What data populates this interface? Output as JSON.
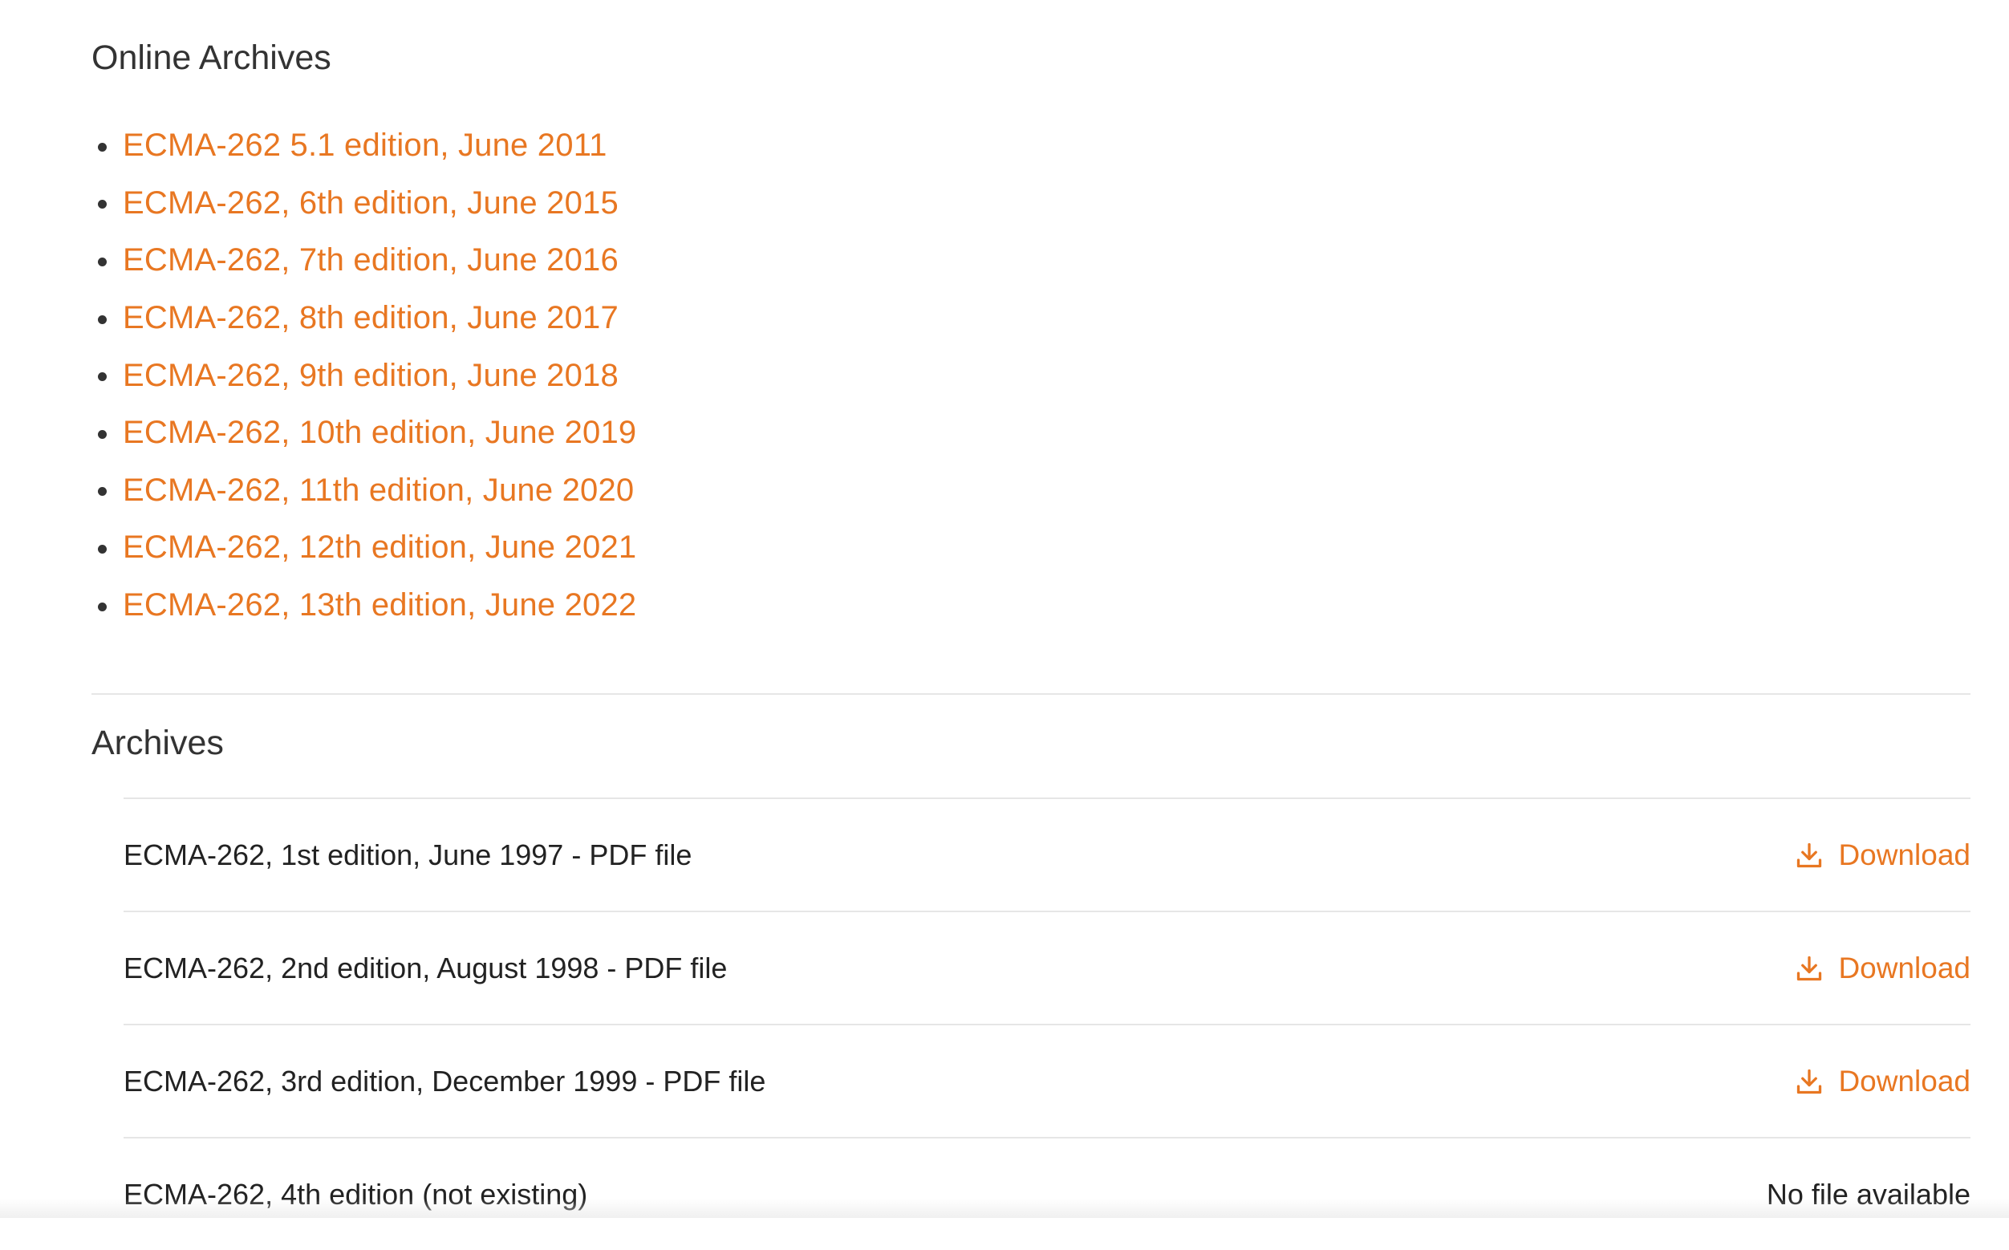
{
  "online_archives": {
    "title": "Online Archives",
    "links": [
      "ECMA-262 5.1 edition, June 2011",
      "ECMA-262, 6th edition, June 2015",
      "ECMA-262, 7th edition, June 2016",
      "ECMA-262, 8th edition, June 2017",
      "ECMA-262, 9th edition, June 2018",
      "ECMA-262, 10th edition, June 2019",
      "ECMA-262, 11th edition, June 2020",
      "ECMA-262, 12th edition, June 2021",
      "ECMA-262, 13th edition, June 2022"
    ]
  },
  "archives": {
    "title": "Archives",
    "rows": [
      {
        "title": "ECMA-262, 1st edition, June 1997 - PDF file",
        "action": "Download",
        "icon": "download-icon"
      },
      {
        "title": "ECMA-262, 2nd edition, August 1998 - PDF file",
        "action": "Download",
        "icon": "download-icon"
      },
      {
        "title": "ECMA-262, 3rd edition, December 1999 - PDF file",
        "action": "Download",
        "icon": "download-icon"
      },
      {
        "title": "ECMA-262, 4th edition (not existing)",
        "status": "No file available"
      }
    ]
  },
  "colors": {
    "accent": "#e87722",
    "text": "#222222",
    "divider": "#e6e6e6"
  }
}
